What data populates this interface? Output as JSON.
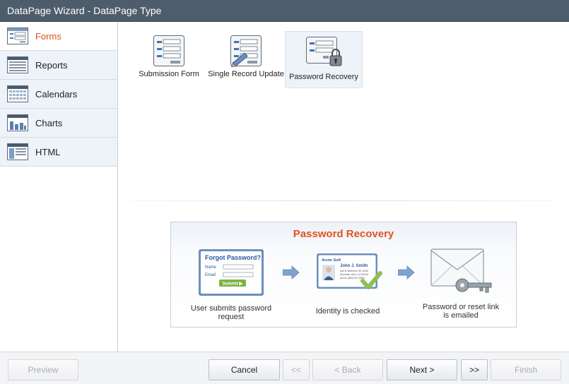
{
  "window": {
    "title": "DataPage Wizard - DataPage Type"
  },
  "sidebar": {
    "items": [
      {
        "label": "Forms",
        "icon": "forms-icon",
        "active": true
      },
      {
        "label": "Reports",
        "icon": "reports-icon",
        "active": false
      },
      {
        "label": "Calendars",
        "icon": "calendars-icon",
        "active": false
      },
      {
        "label": "Charts",
        "icon": "charts-icon",
        "active": false
      },
      {
        "label": "HTML",
        "icon": "html-icon",
        "active": false
      }
    ]
  },
  "types": [
    {
      "label": "Submission Form",
      "icon": "submission-form-icon",
      "selected": false
    },
    {
      "label": "Single Record Update",
      "icon": "single-record-update-icon",
      "selected": false
    },
    {
      "label": "Password Recovery",
      "icon": "password-recovery-icon",
      "selected": true
    }
  ],
  "preview": {
    "title": "Password Recovery",
    "form_card": {
      "heading": "Forgot Password?",
      "name_label": "Name",
      "email_label": "Email",
      "submit_label": "Submit ▶"
    },
    "id_card": {
      "company": "Acme Soft",
      "name": "John J. Smith",
      "line1": "460 N Wisemen Rd, 6030",
      "line2": "Mountain View, CA 94043",
      "line3": "phone (650) 697-8900"
    },
    "steps": [
      {
        "caption_line1": "User submits password",
        "caption_line2": "request"
      },
      {
        "caption_line1": "Identity is checked",
        "caption_line2": ""
      },
      {
        "caption_line1": "Password or reset link",
        "caption_line2": "is emailed"
      }
    ]
  },
  "footer": {
    "preview": "Preview",
    "cancel": "Cancel",
    "first": "<<",
    "back": "< Back",
    "next": "Next >",
    "last": ">>",
    "finish": "Finish"
  },
  "colors": {
    "accent": "#e0531f",
    "titlebar": "#4e5d6c",
    "sidebar_bg": "#eef3fa",
    "submit_green": "#7cb342"
  }
}
